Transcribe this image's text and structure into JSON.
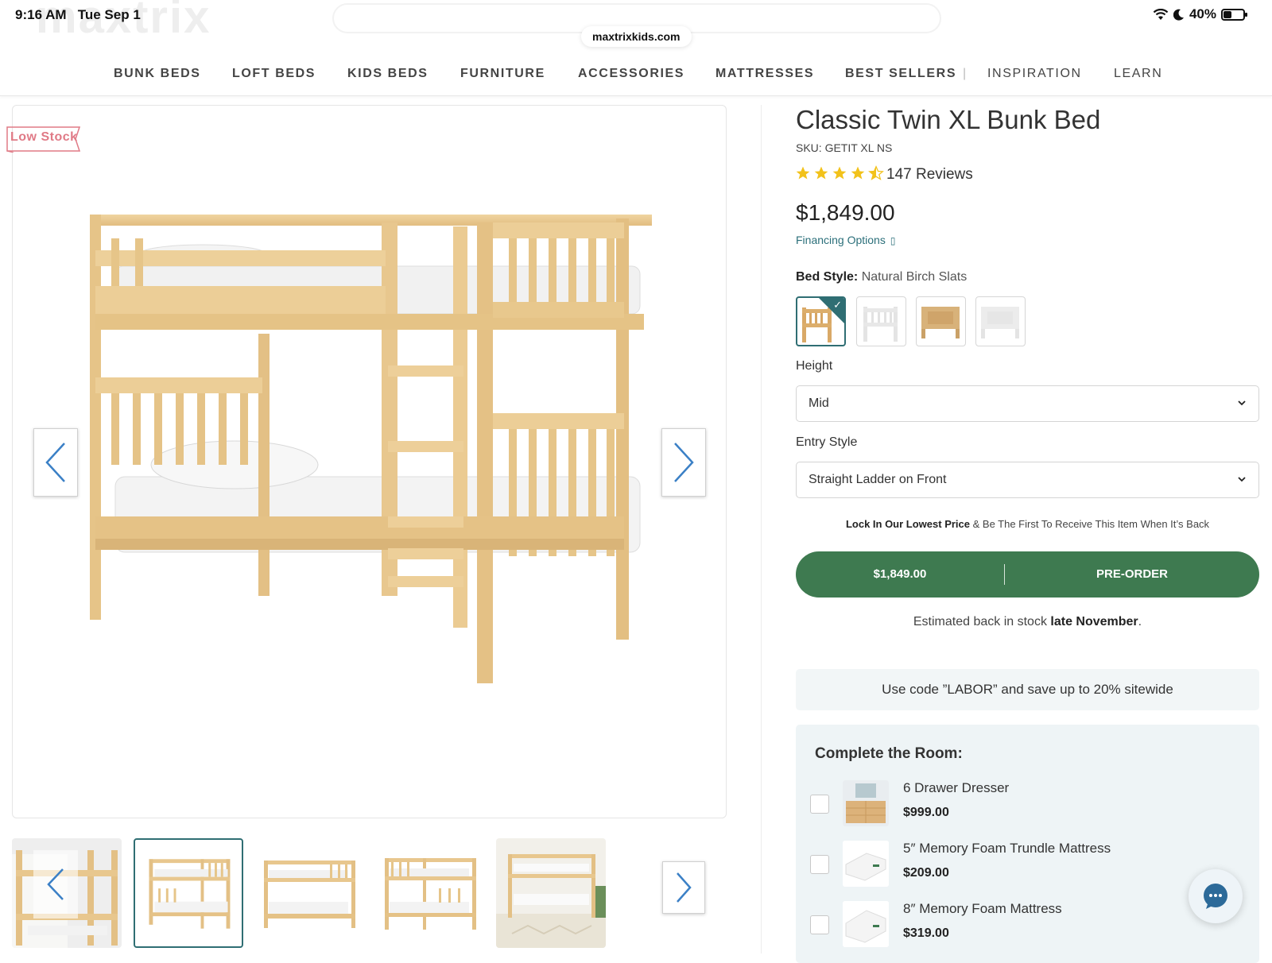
{
  "status_bar": {
    "time": "9:16 AM",
    "date": "Tue Sep 1",
    "battery": "40%"
  },
  "browser": {
    "url": "maxtrixkids.com",
    "ghost_logo": "maxtrix"
  },
  "nav": {
    "items": [
      "BUNK BEDS",
      "LOFT BEDS",
      "KIDS BEDS",
      "FURNITURE",
      "ACCESSORIES",
      "MATTRESSES",
      "BEST SELLERS",
      "INSPIRATION",
      "LEARN"
    ],
    "separator": "|"
  },
  "gallery": {
    "badge": "Low Stock",
    "main_image": "natural-wood-bunk-bed"
  },
  "product": {
    "title": "Classic Twin XL Bunk Bed",
    "sku": "SKU: GETIT XL NS",
    "rating": 4.5,
    "reviews": "147 Reviews",
    "price": "$1,849.00",
    "financing": "Financing Options",
    "bed_style_label": "Bed Style:",
    "bed_style_value": "Natural Birch Slats",
    "height_label": "Height",
    "height_value": "Mid",
    "entry_label": "Entry Style",
    "entry_value": "Straight Ladder on Front",
    "lock_bold": "Lock In Our Lowest Price",
    "lock_rest": " & Be The First To Receive This Item When It’s Back",
    "cta_price": "$1,849.00",
    "cta_action": "PRE-ORDER",
    "stock_prefix": "Estimated back in stock ",
    "stock_bold": "late November",
    "stock_suffix": ".",
    "promo": "Use code ”LABOR” and save up to 20% sitewide"
  },
  "complete_room": {
    "title": "Complete the Room:",
    "items": [
      {
        "name": "6 Drawer Dresser",
        "price": "$999.00"
      },
      {
        "name": "5″ Memory Foam Trundle Mattress",
        "price": "$209.00"
      },
      {
        "name": "8″ Memory Foam Mattress",
        "price": "$319.00"
      }
    ]
  },
  "colors": {
    "accent": "#2f6e73",
    "cta": "#3e7a50",
    "badge": "#e07a86",
    "wood": "#e8c98f",
    "star": "#f2c21b"
  }
}
